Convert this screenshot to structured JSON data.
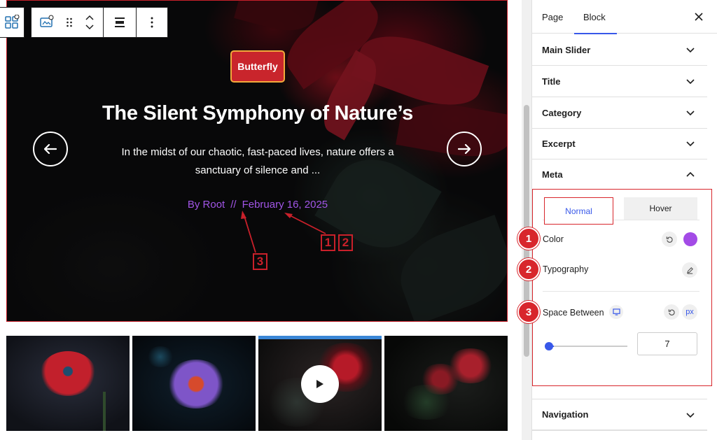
{
  "slider": {
    "category_badge": "Butterfly",
    "title": "The Silent Symphony of Nature’s",
    "excerpt": "In the midst of our chaotic, fast-paced lives, nature offers a sanctuary of silence and ...",
    "meta_author": "By Root",
    "meta_separator": "//",
    "meta_date": "February 16, 2025",
    "prev_icon": "arrow-left-icon",
    "next_icon": "arrow-right-icon"
  },
  "annotations": {
    "box_1": "1",
    "box_2": "2",
    "box_3": "3"
  },
  "toolbar": {
    "block_type_icon": "layout-grid-icon",
    "block_icon": "slider-block-icon",
    "drag_icon": "drag-handle-icon",
    "move_up_icon": "chevron-up-icon",
    "move_down_icon": "chevron-down-icon",
    "align_icon": "align-center-icon",
    "options_icon": "more-vertical-icon"
  },
  "thumbnails": {
    "play_icon": "play-icon"
  },
  "sidebar": {
    "tab_page": "Page",
    "tab_block": "Block",
    "close_icon": "close-icon",
    "panels": [
      {
        "label": "Main Slider"
      },
      {
        "label": "Title"
      },
      {
        "label": "Category"
      },
      {
        "label": "Excerpt"
      },
      {
        "label": "Meta"
      }
    ],
    "meta": {
      "tab_normal": "Normal",
      "tab_hover": "Hover",
      "color_label": "Color",
      "color_value": "#a34be6",
      "typography_label": "Typography",
      "space_between_label": "Space Between",
      "unit": "px",
      "space_between_value": "7",
      "badge_1": "1",
      "badge_2": "2",
      "badge_3": "3"
    },
    "navigation_label": "Navigation"
  },
  "colors": {
    "accent": "#3858e9",
    "annotation_red": "#d8262c",
    "meta_purple": "#a155e6",
    "badge_red": "#c9252c"
  }
}
